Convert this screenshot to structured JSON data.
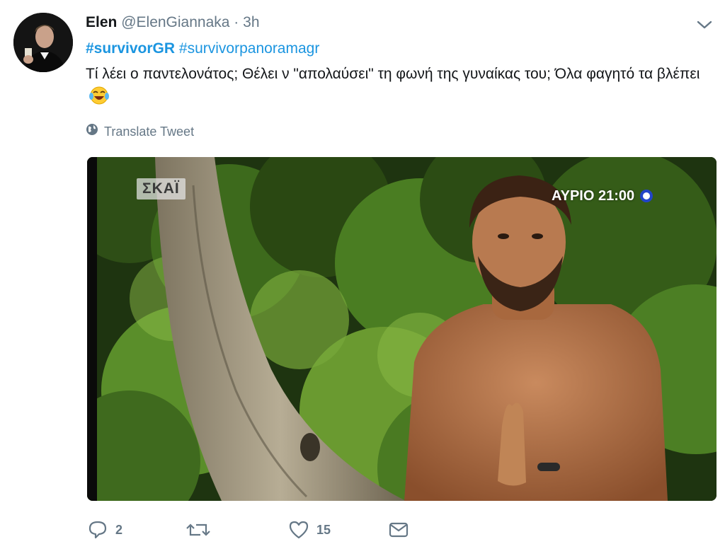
{
  "tweet": {
    "author_name": "Elen",
    "handle": "@ElenGiannaka",
    "separator": "·",
    "time": "3h",
    "hashtag_1": "#survivorGR",
    "hashtag_2": "#survivorpanoramagr",
    "text": "Τί λέει ο παντελονάτος; Θέλει ν \"απολαύσει\" τη φωνή της γυναίκας του; Όλα φαγητό τα βλέπει",
    "translate_label": "Translate Tweet"
  },
  "media": {
    "channel_logo": "ΣΚΑΪ",
    "airtime": "ΑΥΡΙΟ 21:00"
  },
  "actions": {
    "reply_count": "2",
    "retweet_count": "",
    "like_count": "15"
  },
  "colors": {
    "link": "#1b95e0",
    "secondary": "#657786",
    "text": "#14171a"
  },
  "icons": [
    "avatar",
    "chevron-down-icon",
    "laughing-emoji-icon",
    "globe-icon",
    "reply-icon",
    "retweet-icon",
    "like-icon",
    "message-icon"
  ]
}
